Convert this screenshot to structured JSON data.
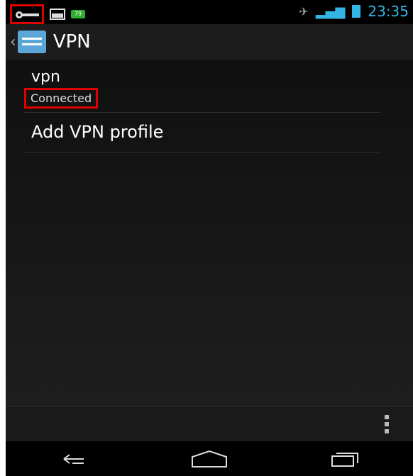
{
  "status_bar": {
    "time": "23:35",
    "battery_percent_badge": "79",
    "icons": [
      "vpn-key-icon",
      "picture-icon",
      "battery-badge-icon",
      "mute-icon",
      "signal-icon",
      "battery-icon"
    ]
  },
  "action_bar": {
    "title": "VPN",
    "icons": [
      "back-chevron-icon",
      "settings-icon"
    ]
  },
  "vpn_list": {
    "items": [
      {
        "name": "vpn",
        "status": "Connected"
      }
    ],
    "add_profile_label": "Add VPN profile"
  },
  "bottom_bar": {
    "icons": [
      "overflow-menu-icon"
    ]
  },
  "nav_bar": {
    "icons": [
      "back-icon",
      "home-icon",
      "recent-apps-icon"
    ]
  },
  "colors": {
    "accent": "#33b5e5",
    "highlight": "#e00000"
  }
}
